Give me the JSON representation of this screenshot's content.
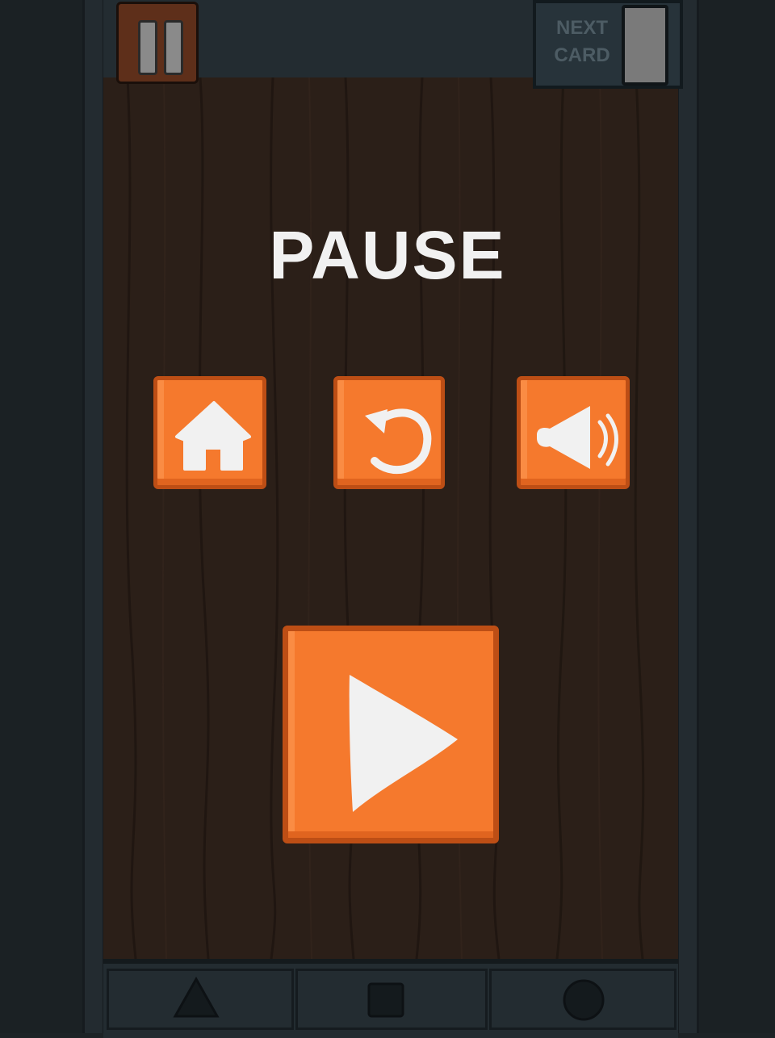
{
  "topbar": {
    "next_card_label": "NEXT CARD",
    "pause_icon": "pause-icon"
  },
  "overlay": {
    "title": "PAUSE",
    "buttons": [
      {
        "name": "home",
        "icon": "home-icon"
      },
      {
        "name": "restart",
        "icon": "restart-icon"
      },
      {
        "name": "sound",
        "icon": "speaker-icon"
      }
    ],
    "play_icon": "play-icon"
  },
  "navbar": {
    "items": [
      {
        "name": "back",
        "icon": "triangle-icon"
      },
      {
        "name": "home",
        "icon": "square-icon"
      },
      {
        "name": "recents",
        "icon": "circle-icon"
      }
    ]
  },
  "colors": {
    "button_orange": "#f5792d",
    "button_border": "#bd4e15",
    "board_wood": "#2b1f18",
    "frame": "#232c31",
    "icon_white": "#f1f1f1"
  }
}
